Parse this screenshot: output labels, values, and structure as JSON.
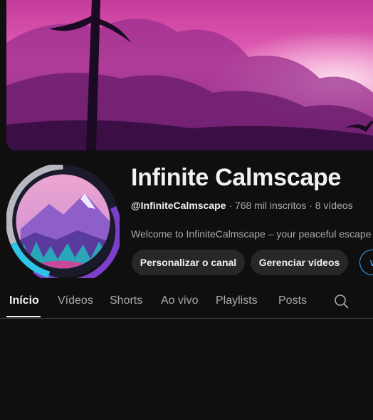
{
  "channel": {
    "title": "Infinite Calmscape",
    "handle": "@InfiniteCalmscape",
    "subscribers": " · 768 mil inscritos",
    "videos": " · 8 vídeos",
    "description": "Welcome to InfiniteCalmscape – your peaceful escape"
  },
  "buttons": {
    "customize": "Personalizar o canal",
    "manage": "Gerenciar vídeos",
    "extra": "∨"
  },
  "tabs": [
    {
      "label": "Início",
      "active": true
    },
    {
      "label": "Vídeos"
    },
    {
      "label": "Shorts"
    },
    {
      "label": "Ao vivo"
    },
    {
      "label": "Playlists"
    },
    {
      "label": "Posts"
    }
  ],
  "icons": {
    "search": "search-icon",
    "banner": "synthwave-sunset-banner",
    "avatar": "mountain-landscape-avatar"
  },
  "colors": {
    "background": "#0f0f0f",
    "accent": "#3ea6ff",
    "button_bg": "#272727",
    "muted_text": "#aaaaaa"
  }
}
